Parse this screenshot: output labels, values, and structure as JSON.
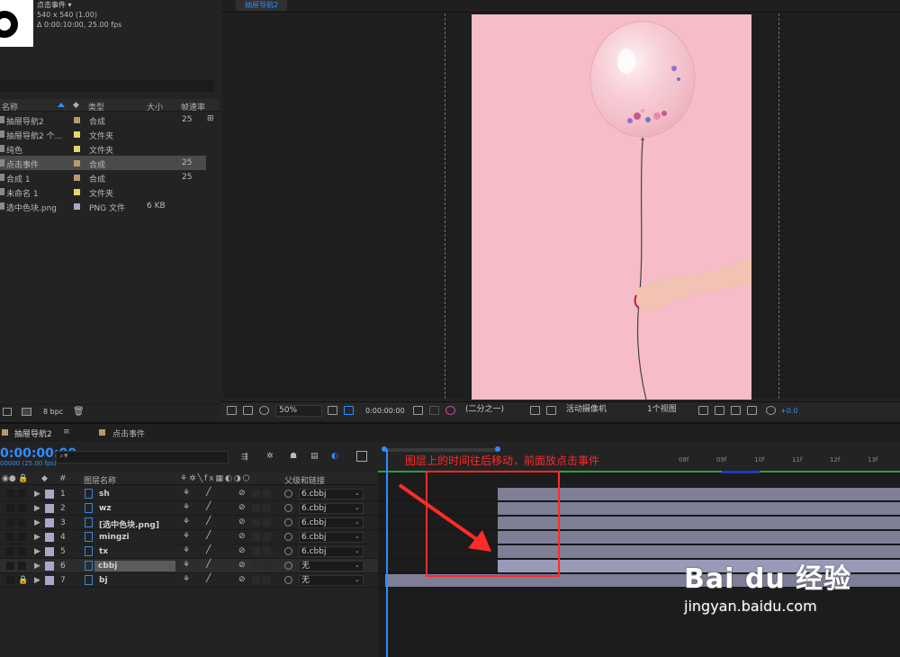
{
  "project": {
    "selected_name": "点击事件 ▾",
    "dims": "540 x 540 (1.00)",
    "duration": "Δ 0:00:10:00, 25.00 fps",
    "search_placeholder": "",
    "columns": [
      "名称",
      "类型",
      "大小",
      "帧速率"
    ],
    "items": [
      {
        "name": "抽屉导航2",
        "type": "合成",
        "size": "",
        "fps": "25",
        "label_color": "#b59a6c"
      },
      {
        "name": "抽屉导航2 个...",
        "type": "文件夹",
        "size": "",
        "fps": "",
        "label_color": "#e9d46c"
      },
      {
        "name": "纯色",
        "type": "文件夹",
        "size": "",
        "fps": "",
        "label_color": "#e9d46c"
      },
      {
        "name": "点击事件",
        "type": "合成",
        "size": "",
        "fps": "25",
        "label_color": "#b59a6c"
      },
      {
        "name": "合成 1",
        "type": "合成",
        "size": "",
        "fps": "25",
        "label_color": "#b59a6c"
      },
      {
        "name": "未命名 1",
        "type": "文件夹",
        "size": "",
        "fps": "",
        "label_color": "#e9d46c"
      },
      {
        "name": "选中色块.png",
        "type": "PNG 文件",
        "size": "6 KB",
        "fps": "",
        "label_color": "#a8a8c8"
      }
    ],
    "bpc": "8 bpc"
  },
  "viewer": {
    "tab": "抽屉导航2",
    "zoom": "50%",
    "timecode": "0:00:00:00",
    "resolution": "(二分之一)",
    "camera": "活动摄像机",
    "views": "1个视图",
    "exposure": "+0.0"
  },
  "timeline": {
    "tabs": [
      "抽屉导航2",
      "点击事件"
    ],
    "timecode": "0:00:00:00",
    "fps": "00000 (25.00 fps)",
    "columns": {
      "num": "#",
      "name": "图层名称",
      "parent": "父级和链接"
    },
    "layers": [
      {
        "num": "1",
        "name": "sh",
        "parent": "6.cbbj"
      },
      {
        "num": "2",
        "name": "wz",
        "parent": "6.cbbj"
      },
      {
        "num": "3",
        "name": "[选中色块.png]",
        "parent": "6.cbbj"
      },
      {
        "num": "4",
        "name": "mingzi",
        "parent": "6.cbbj"
      },
      {
        "num": "5",
        "name": "tx",
        "parent": "6.cbbj"
      },
      {
        "num": "6",
        "name": "cbbj",
        "parent": "无"
      },
      {
        "num": "7",
        "name": "bj",
        "parent": "无"
      }
    ],
    "ruler_ticks": [
      "08f",
      "09f",
      "10f",
      "11f",
      "12f",
      "13f"
    ],
    "annotation": "图层上的时间往后移动，前面放点击事件"
  },
  "watermark": {
    "brand": "Bai du 经验",
    "url": "jingyan.baidu.com"
  },
  "colors": {
    "accent": "#2f8cff",
    "annotation": "#ff2a2a",
    "layer_bar": "#7e7e96"
  }
}
